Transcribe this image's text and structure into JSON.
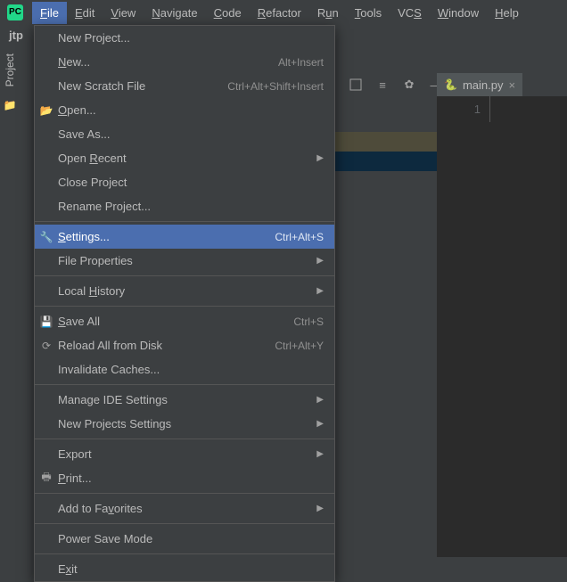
{
  "logo_text": "PC",
  "menubar": [
    {
      "label": "File",
      "mn": "F",
      "rest": "ile",
      "open": true
    },
    {
      "label": "Edit",
      "mn": "E",
      "rest": "dit"
    },
    {
      "label": "View",
      "mn": "V",
      "rest": "iew"
    },
    {
      "label": "Navigate",
      "mn": "N",
      "rest": "avigate"
    },
    {
      "label": "Code",
      "mn": "C",
      "rest": "ode"
    },
    {
      "label": "Refactor",
      "mn": "R",
      "rest": "efactor"
    },
    {
      "label": "Run",
      "mn": "u",
      "pre": "R",
      "rest": "n"
    },
    {
      "label": "Tools",
      "mn": "T",
      "rest": "ools"
    },
    {
      "label": "VCS",
      "mn": "S",
      "pre": "VC",
      "rest": ""
    },
    {
      "label": "Window",
      "mn": "W",
      "rest": "indow"
    },
    {
      "label": "Help",
      "mn": "H",
      "rest": "elp"
    }
  ],
  "breadcrumb": "jtp",
  "sidebar_tab": "Project",
  "editor": {
    "tab_label": "main.py",
    "line_numbers": [
      "1"
    ]
  },
  "file_menu": [
    {
      "type": "item",
      "label": "New Project..."
    },
    {
      "type": "item",
      "label": "New...",
      "mn": "N",
      "rest": "ew...",
      "shortcut": "Alt+Insert"
    },
    {
      "type": "item",
      "label": "New Scratch File",
      "shortcut": "Ctrl+Alt+Shift+Insert"
    },
    {
      "type": "item",
      "label": "Open...",
      "mn": "O",
      "rest": "pen...",
      "icon": "open"
    },
    {
      "type": "item",
      "label": "Save As..."
    },
    {
      "type": "item",
      "label": "Open Recent",
      "mn": "R",
      "pre": "Open ",
      "rest": "ecent",
      "submenu": true
    },
    {
      "type": "item",
      "label": "Close Project"
    },
    {
      "type": "item",
      "label": "Rename Project..."
    },
    {
      "type": "sep"
    },
    {
      "type": "item",
      "label": "Settings...",
      "mn": "S",
      "rest": "ettings...",
      "shortcut": "Ctrl+Alt+S",
      "icon": "wrench",
      "hover": true
    },
    {
      "type": "item",
      "label": "File Properties",
      "submenu": true
    },
    {
      "type": "sep"
    },
    {
      "type": "item",
      "label": "Local History",
      "mn": "H",
      "pre": "Local ",
      "rest": "istory",
      "submenu": true
    },
    {
      "type": "sep"
    },
    {
      "type": "item",
      "label": "Save All",
      "mn": "S",
      "rest": "ave All",
      "shortcut": "Ctrl+S",
      "icon": "save"
    },
    {
      "type": "item",
      "label": "Reload All from Disk",
      "shortcut": "Ctrl+Alt+Y",
      "icon": "reload"
    },
    {
      "type": "item",
      "label": "Invalidate Caches..."
    },
    {
      "type": "sep"
    },
    {
      "type": "item",
      "label": "Manage IDE Settings",
      "submenu": true
    },
    {
      "type": "item",
      "label": "New Projects Settings",
      "submenu": true
    },
    {
      "type": "sep"
    },
    {
      "type": "item",
      "label": "Export",
      "submenu": true
    },
    {
      "type": "item",
      "label": "Print...",
      "mn": "P",
      "rest": "rint...",
      "icon": "print"
    },
    {
      "type": "sep"
    },
    {
      "type": "item",
      "label": "Add to Favorites",
      "mn": "v",
      "pre": "Add to Fa",
      "rest": "orites",
      "submenu": true
    },
    {
      "type": "sep"
    },
    {
      "type": "item",
      "label": "Power Save Mode"
    },
    {
      "type": "sep"
    },
    {
      "type": "item",
      "label": "Exit",
      "mn": "x",
      "pre": "E",
      "rest": "it"
    }
  ],
  "icons": {
    "open": "📂",
    "wrench": "🔧",
    "save": "💾",
    "reload": "⟳",
    "print": "🖶"
  }
}
